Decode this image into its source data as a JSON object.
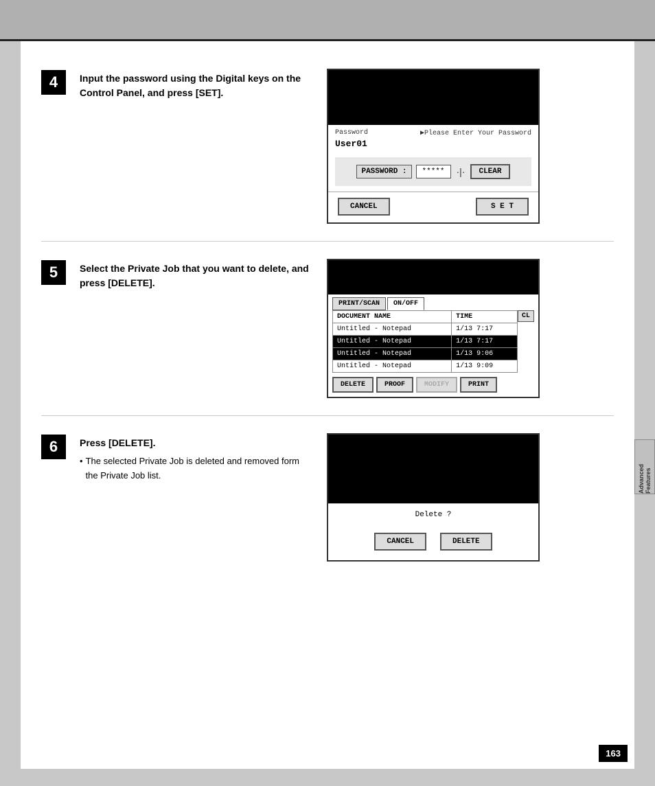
{
  "topBar": {},
  "steps": [
    {
      "number": "4",
      "instruction": "Input the password using the Digital keys on the Control Panel, and press [SET].",
      "subText": null
    },
    {
      "number": "5",
      "instruction": "Select the Private Job that you want to delete, and press [DELETE].",
      "subText": null
    },
    {
      "number": "6",
      "instruction": "Press [DELETE].",
      "subText": "The selected Private Job is deleted and removed form the Private Job list."
    }
  ],
  "screen1": {
    "passwordLabel": "Password",
    "promptText": "▶Please Enter Your Password",
    "userText": "User01",
    "pwFieldLabel": "PASSWORD :",
    "pwValue": "*****",
    "dotSep": "·|·",
    "clearBtn": "CLEAR",
    "cancelBtn": "CANCEL",
    "setBtn": "S E T"
  },
  "screen2": {
    "tab1": "PRINT/SCAN",
    "tab2": "ON/OFF",
    "clBtn": "CL",
    "colName": "DOCUMENT NAME",
    "colTime": "TIME",
    "rows": [
      {
        "name": "Untitled - Notepad",
        "time": "1/13  7:17",
        "selected": false
      },
      {
        "name": "Untitled - Notepad",
        "time": "1/13  7:17",
        "selected": true
      },
      {
        "name": "Untitled - Notepad",
        "time": "1/13  9:06",
        "selected": true
      },
      {
        "name": "Untitled - Notepad",
        "time": "1/13  9:09",
        "selected": false
      }
    ],
    "deleteBtn": "DELETE",
    "proofBtn": "PROOF",
    "modifyBtn": "MODIFY",
    "printBtn": "PRINT"
  },
  "screen3": {
    "deleteQuestion": "Delete ?",
    "cancelBtn": "CANCEL",
    "deleteBtn": "DELETE"
  },
  "sideTab": {
    "line1": "Advanced",
    "line2": "Features"
  },
  "pageNumber": "163"
}
